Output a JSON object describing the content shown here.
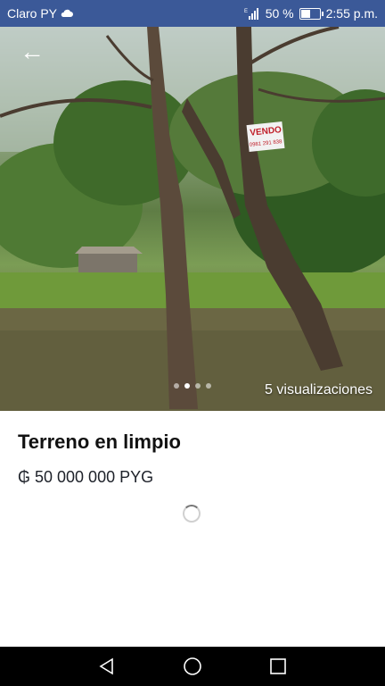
{
  "status_bar": {
    "carrier": "Claro PY",
    "battery_percent": "50 %",
    "battery_level": 0.5,
    "time": "2:55 p.m."
  },
  "photo": {
    "sign_text_1": "VENDO",
    "sign_text_2": "0981 291 838",
    "views": "5 visualizaciones",
    "image_count": 4,
    "active_image": 2
  },
  "listing": {
    "title": "Terreno en limpio",
    "price": "₲ 50 000 000 PYG"
  },
  "colors": {
    "status_bar": "#3b5998",
    "nav_bar": "#000000",
    "title": "#111111"
  },
  "icons": {
    "back": "arrow-left",
    "nav_back": "triangle-back",
    "nav_home": "circle-home",
    "nav_recent": "square-recent"
  }
}
